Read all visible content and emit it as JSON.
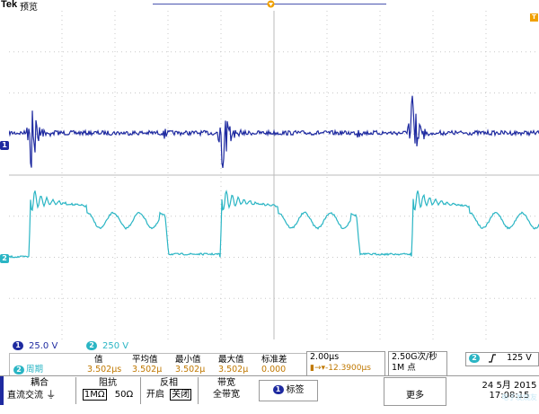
{
  "header": {
    "brand": "Tek",
    "acq_state": "预览"
  },
  "channels": {
    "ch1": {
      "id": "1",
      "color": "#1e2aa0"
    },
    "ch2": {
      "id": "2",
      "color": "#2ab5c4"
    }
  },
  "scale": {
    "ch1_label": "25.0 V",
    "ch2_label": "250 V"
  },
  "measurements": {
    "channel": "2",
    "type": "周期",
    "headers": [
      "值",
      "平均值",
      "最小值",
      "最大值",
      "标准差"
    ],
    "values": [
      "3.502μs",
      "3.502μ",
      "3.502μ",
      "3.502μ",
      "0.000"
    ]
  },
  "timebase": {
    "per_div": "2.00μs",
    "position": "-12.3900μs"
  },
  "acquisition": {
    "rate": "2.50G次/秒",
    "record": "1M 点"
  },
  "trigger": {
    "source": "2",
    "slope_icon": "rising-edge-icon",
    "level": "125 V"
  },
  "softkeys": {
    "coupling_title": "耦合",
    "coupling_dc": "直流",
    "coupling_ac": "交流",
    "impedance_title": "阻抗",
    "impedance_1m": "1MΩ",
    "impedance_50": "50Ω",
    "invert_title": "反相",
    "invert_on": "开启",
    "invert_off": "关闭",
    "bandwidth_title": "带宽",
    "bandwidth_value": "全带宽",
    "label_button": "标签",
    "more_button": "更多"
  },
  "datetime": {
    "date": "24 5月 2015",
    "time": "17:08:15"
  },
  "watermark": "电子发烧友"
}
